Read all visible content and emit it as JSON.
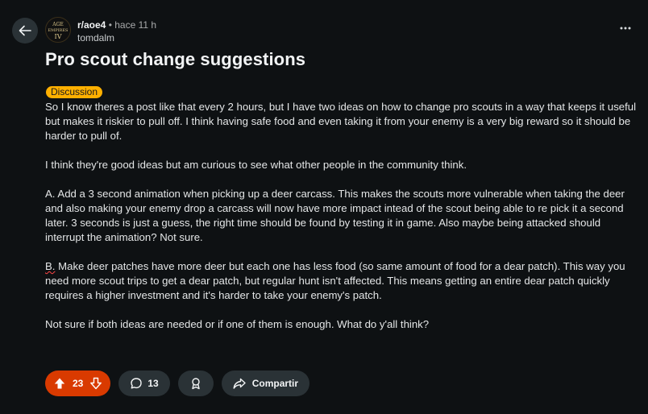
{
  "header": {
    "subreddit": "r/aoe4",
    "separator": "•",
    "time": "hace 11 h",
    "author": "tomdalm",
    "avatar_text": [
      "AGE",
      "EMPIRES",
      "IV"
    ]
  },
  "post": {
    "title": "Pro scout change suggestions",
    "flair": "Discussion",
    "paragraphs": [
      "So I know theres a post like that every 2 hours, but I have two ideas on how to change pro scouts in a way that keeps it useful but makes it riskier to pull off. I think having safe food and even taking it from your enemy is a very big reward so it should be harder to pull of.",
      "I think they're good ideas but am curious to see what other people in the community think.",
      "A. Add a 3 second animation when picking up a deer carcass. This makes the scouts more vulnerable when taking the deer and also making your enemy drop a carcass will now have more impact intead of the scout being able to re pick it a second later. 3 seconds is just a guess, the right time should be found by testing it in game. Also maybe being attacked should interrupt the animation? Not sure.",
      "Not sure if both ideas are needed or if one of them is enough. What do y'all think?"
    ],
    "paragraph_b_prefix": "B.",
    "paragraph_b_rest": " Make deer patches have more deer but each one has less food (so same amount of food for a dear patch). This way you need more scout trips to get a dear patch, but regular hunt isn't affected. This means getting an entire dear patch quickly requires a higher investment and it's harder to take your enemy's patch."
  },
  "actions": {
    "votes": "23",
    "comments": "13",
    "share_label": "Compartir"
  },
  "icons": {
    "back": "arrow-left-icon",
    "more": "ellipsis-icon",
    "upvote": "arrow-up-icon",
    "downvote": "arrow-down-icon",
    "comment": "speech-bubble-icon",
    "award": "award-icon",
    "share": "share-arrow-icon"
  },
  "colors": {
    "background": "#0e1113",
    "vote_active": "#d93a00",
    "flair": "#ffb000",
    "pill": "#2a3236"
  }
}
